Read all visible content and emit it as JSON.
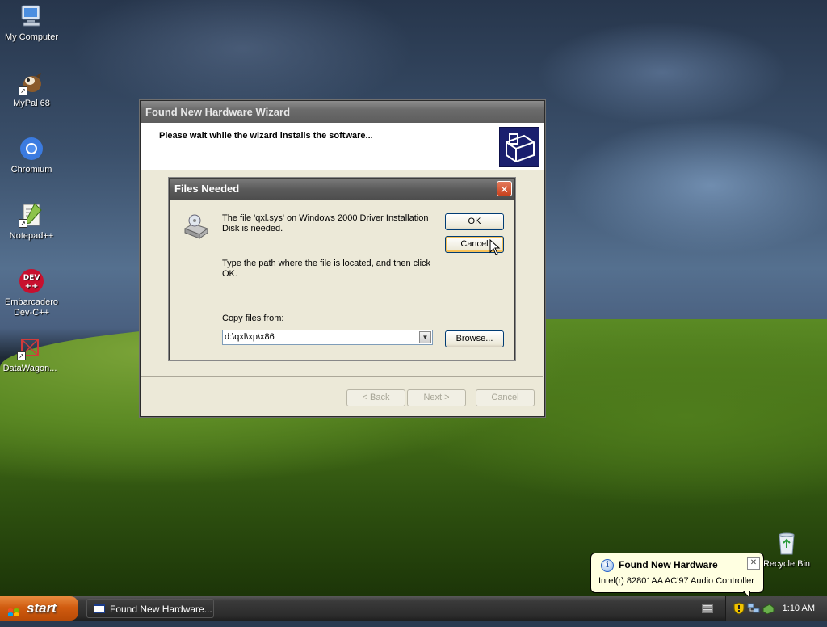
{
  "desktop": {
    "icons": [
      {
        "label": "My Computer"
      },
      {
        "label": "MyPal 68"
      },
      {
        "label": "Chromium"
      },
      {
        "label": "Notepad++"
      },
      {
        "label": "Embarcadero Dev-C++"
      },
      {
        "label": "DataWagon..."
      },
      {
        "label": "Recycle Bin"
      }
    ]
  },
  "wizard": {
    "title": "Found New Hardware Wizard",
    "heading": "Please wait while the wizard installs the software...",
    "buttons": {
      "back": "< Back",
      "next": "Next >",
      "cancel": "Cancel"
    }
  },
  "dialog": {
    "title": "Files Needed",
    "message1": "The file 'qxl.sys' on Windows 2000 Driver Installation Disk is needed.",
    "message2": "Type the path where the file is located, and then click OK.",
    "copy_label": "Copy files from:",
    "copy_value": "d:\\qxl\\xp\\x86",
    "buttons": {
      "ok": "OK",
      "cancel": "Cancel",
      "browse": "Browse..."
    },
    "close": "✕"
  },
  "balloon": {
    "title": "Found New Hardware",
    "text": "Intel(r) 82801AA AC'97 Audio Controller",
    "info_glyph": "i",
    "close_glyph": "✕"
  },
  "taskbar": {
    "start_label": "start",
    "task_button_label": "Found New Hardware...",
    "clock": "1:10 AM"
  },
  "colors": {
    "start_orange": "#d15c10",
    "window_face": "#ece9d8",
    "close_red": "#c8411d",
    "balloon_bg": "#ffffe1"
  }
}
